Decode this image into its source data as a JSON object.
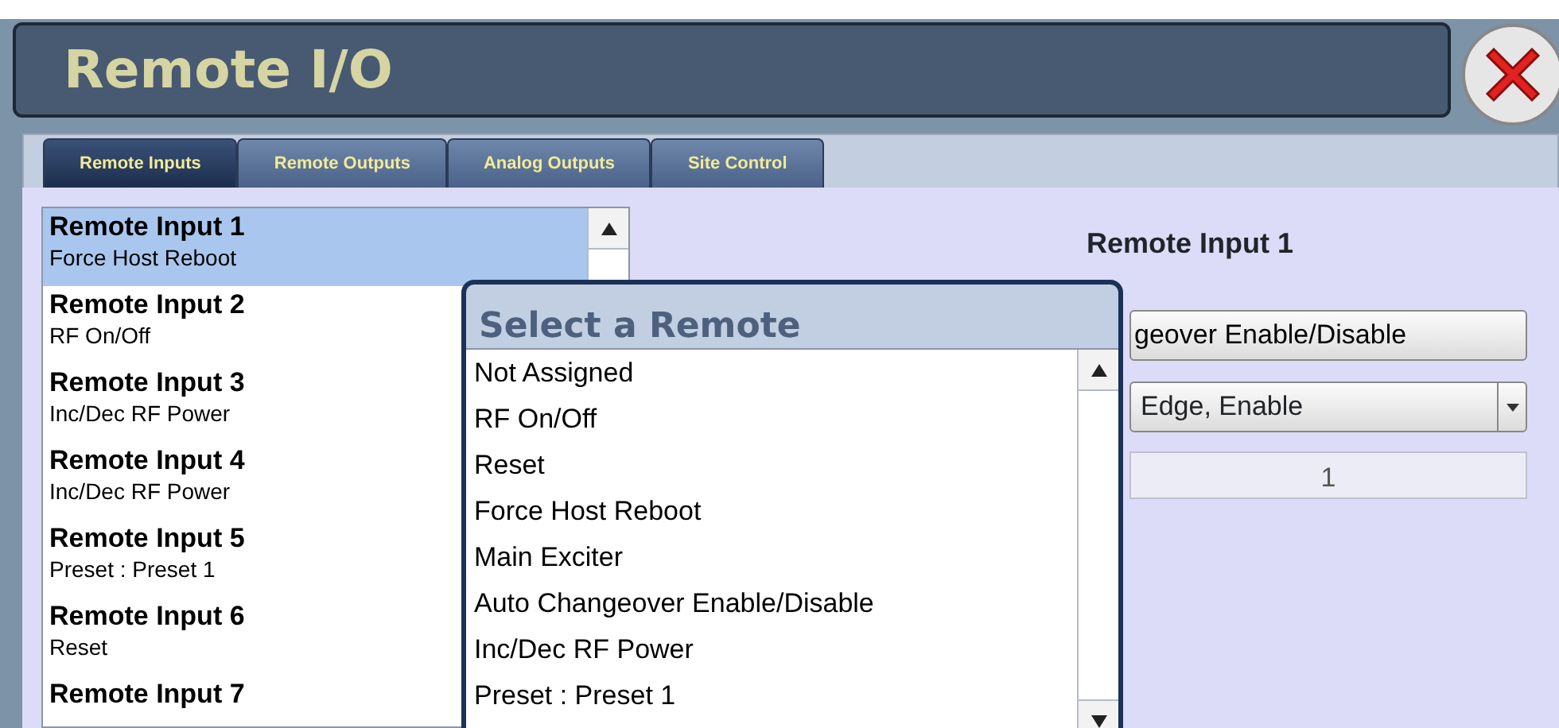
{
  "window": {
    "title": "Remote I/O"
  },
  "tabs": [
    {
      "label": "Remote Inputs",
      "selected": true
    },
    {
      "label": "Remote Outputs",
      "selected": false
    },
    {
      "label": "Analog Outputs",
      "selected": false
    },
    {
      "label": "Site Control",
      "selected": false
    }
  ],
  "inputs": [
    {
      "name": "Remote Input 1",
      "assignment": "Force Host Reboot",
      "selected": true
    },
    {
      "name": "Remote Input 2",
      "assignment": "RF On/Off",
      "selected": false
    },
    {
      "name": "Remote Input 3",
      "assignment": "Inc/Dec RF Power",
      "selected": false
    },
    {
      "name": "Remote Input 4",
      "assignment": "Inc/Dec RF Power",
      "selected": false
    },
    {
      "name": "Remote Input 5",
      "assignment": "Preset : Preset 1",
      "selected": false
    },
    {
      "name": "Remote Input 6",
      "assignment": "Reset",
      "selected": false
    },
    {
      "name": "Remote Input 7",
      "selected": false
    }
  ],
  "detail": {
    "title": "Remote Input 1",
    "function_button": "geover Enable/Disable",
    "mode_select": "Edge, Enable",
    "value": "1"
  },
  "popup": {
    "title": "Select a Remote",
    "options": [
      "Not Assigned",
      "RF On/Off",
      "Reset",
      "Force Host Reboot",
      "Main Exciter",
      "Auto Changeover Enable/Disable",
      "Inc/Dec RF Power",
      "Preset : Preset 1"
    ]
  }
}
